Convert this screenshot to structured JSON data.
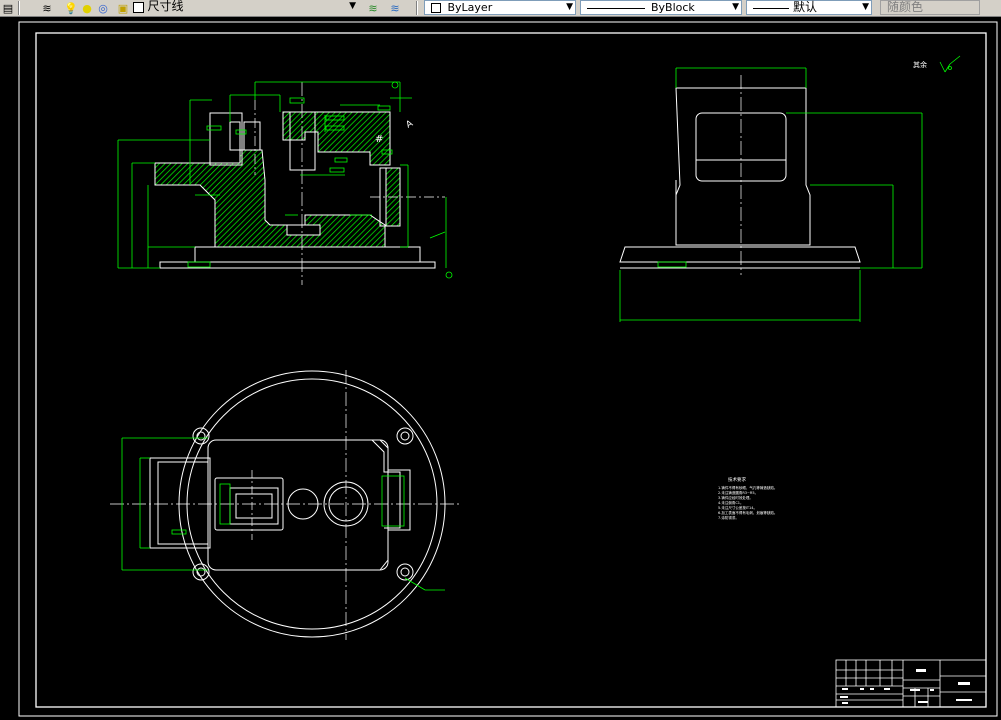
{
  "toolbar": {
    "dim_style": "尺寸线",
    "color": "ByLayer",
    "linetype": "ByBlock",
    "lineweight": "默认",
    "plotstyle": "随颜色"
  },
  "drawing": {
    "roughness_label": "其余",
    "notes_title": "技术要求",
    "notes": [
      "1.铸件不得有砂眼、气孔等铸造缺陷。",
      "2.未注铸造圆角R3~R5。",
      "3.铸件应经时效处理。",
      "4.未注倒角C1。",
      "5.未注尺寸公差按IT14。",
      "6.加工表面不得有毛刺、划痕等缺陷。",
      "7.涂防锈漆。"
    ]
  },
  "colors": {
    "background": "#000000",
    "line_white": "#ffffff",
    "dim_green": "#00ff00",
    "toolbar_bg": "#d4d0c8"
  }
}
